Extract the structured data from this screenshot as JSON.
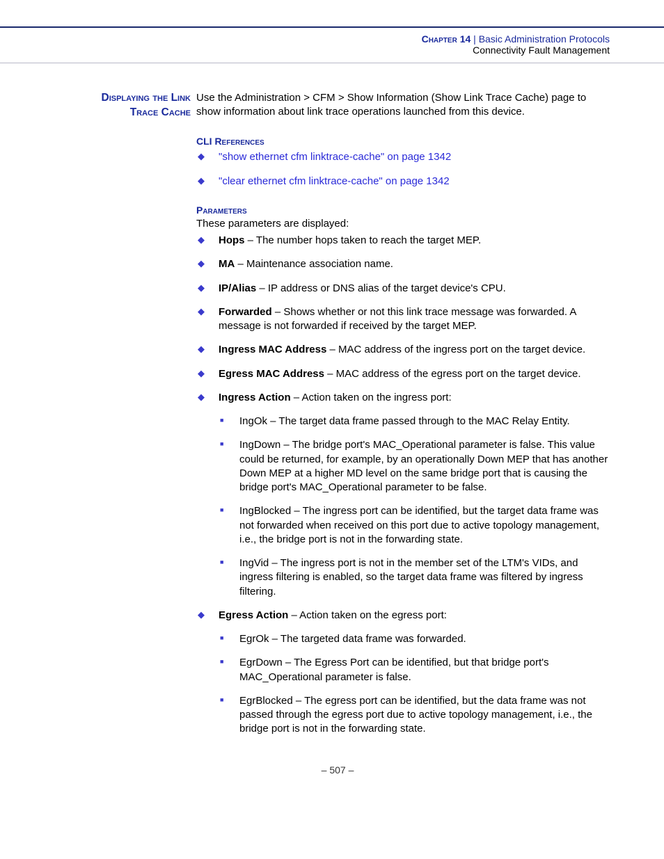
{
  "header": {
    "chapter_label": "Chapter 14",
    "separator": "  |  ",
    "chapter_title": "Basic Administration Protocols",
    "subtitle": "Connectivity Fault Management"
  },
  "section": {
    "title_line1": "Displaying the Link",
    "title_line2": "Trace Cache",
    "intro": "Use the Administration > CFM > Show Information (Show Link Trace Cache) page to show information about link trace operations launched from this device."
  },
  "cli": {
    "heading": "CLI References",
    "items": [
      "\"show ethernet cfm linktrace-cache\" on page 1342",
      "\"clear ethernet cfm linktrace-cache\" on page 1342"
    ]
  },
  "params": {
    "heading": "Parameters",
    "intro": "These parameters are displayed:",
    "items": [
      {
        "name": "Hops",
        "desc": " – The number hops taken to reach the target MEP."
      },
      {
        "name": "MA",
        "desc": " – Maintenance association name."
      },
      {
        "name": "IP/Alias",
        "desc": " – IP address or DNS alias of the target device's CPU."
      },
      {
        "name": "Forwarded",
        "desc": " – Shows whether or not this link trace message was forwarded. A message is not forwarded if received by the target MEP."
      },
      {
        "name": "Ingress MAC Address",
        "desc": " – MAC address of the ingress port on the target device."
      },
      {
        "name": "Egress MAC Address",
        "desc": " – MAC address of the egress port on the target device."
      },
      {
        "name": "Ingress Action",
        "desc": " – Action taken on the ingress port:",
        "sub": [
          "IngOk – The target data frame passed through to the MAC Relay Entity.",
          "IngDown – The bridge port's MAC_Operational parameter is false. This value could be returned, for example, by an operationally Down MEP that has another Down MEP at a higher MD level on the same bridge port that is causing the bridge port's MAC_Operational parameter to be false.",
          "IngBlocked – The ingress port can be identified, but the target data frame was not forwarded when received on this port due to active topology management, i.e., the bridge port is not in the forwarding state.",
          "IngVid – The ingress port is not in the member set of the LTM's VIDs, and ingress filtering is enabled, so the target data frame was filtered by ingress filtering."
        ]
      },
      {
        "name": "Egress Action",
        "desc": " – Action taken on the egress port:",
        "sub": [
          "EgrOk – The targeted data frame was forwarded.",
          "EgrDown – The Egress Port can be identified, but that bridge port's MAC_Operational parameter is false.",
          "EgrBlocked – The egress port can be identified, but the data frame was not passed through the egress port due to active topology management, i.e., the bridge port is not in the forwarding state."
        ]
      }
    ]
  },
  "footer": "–  507  –"
}
